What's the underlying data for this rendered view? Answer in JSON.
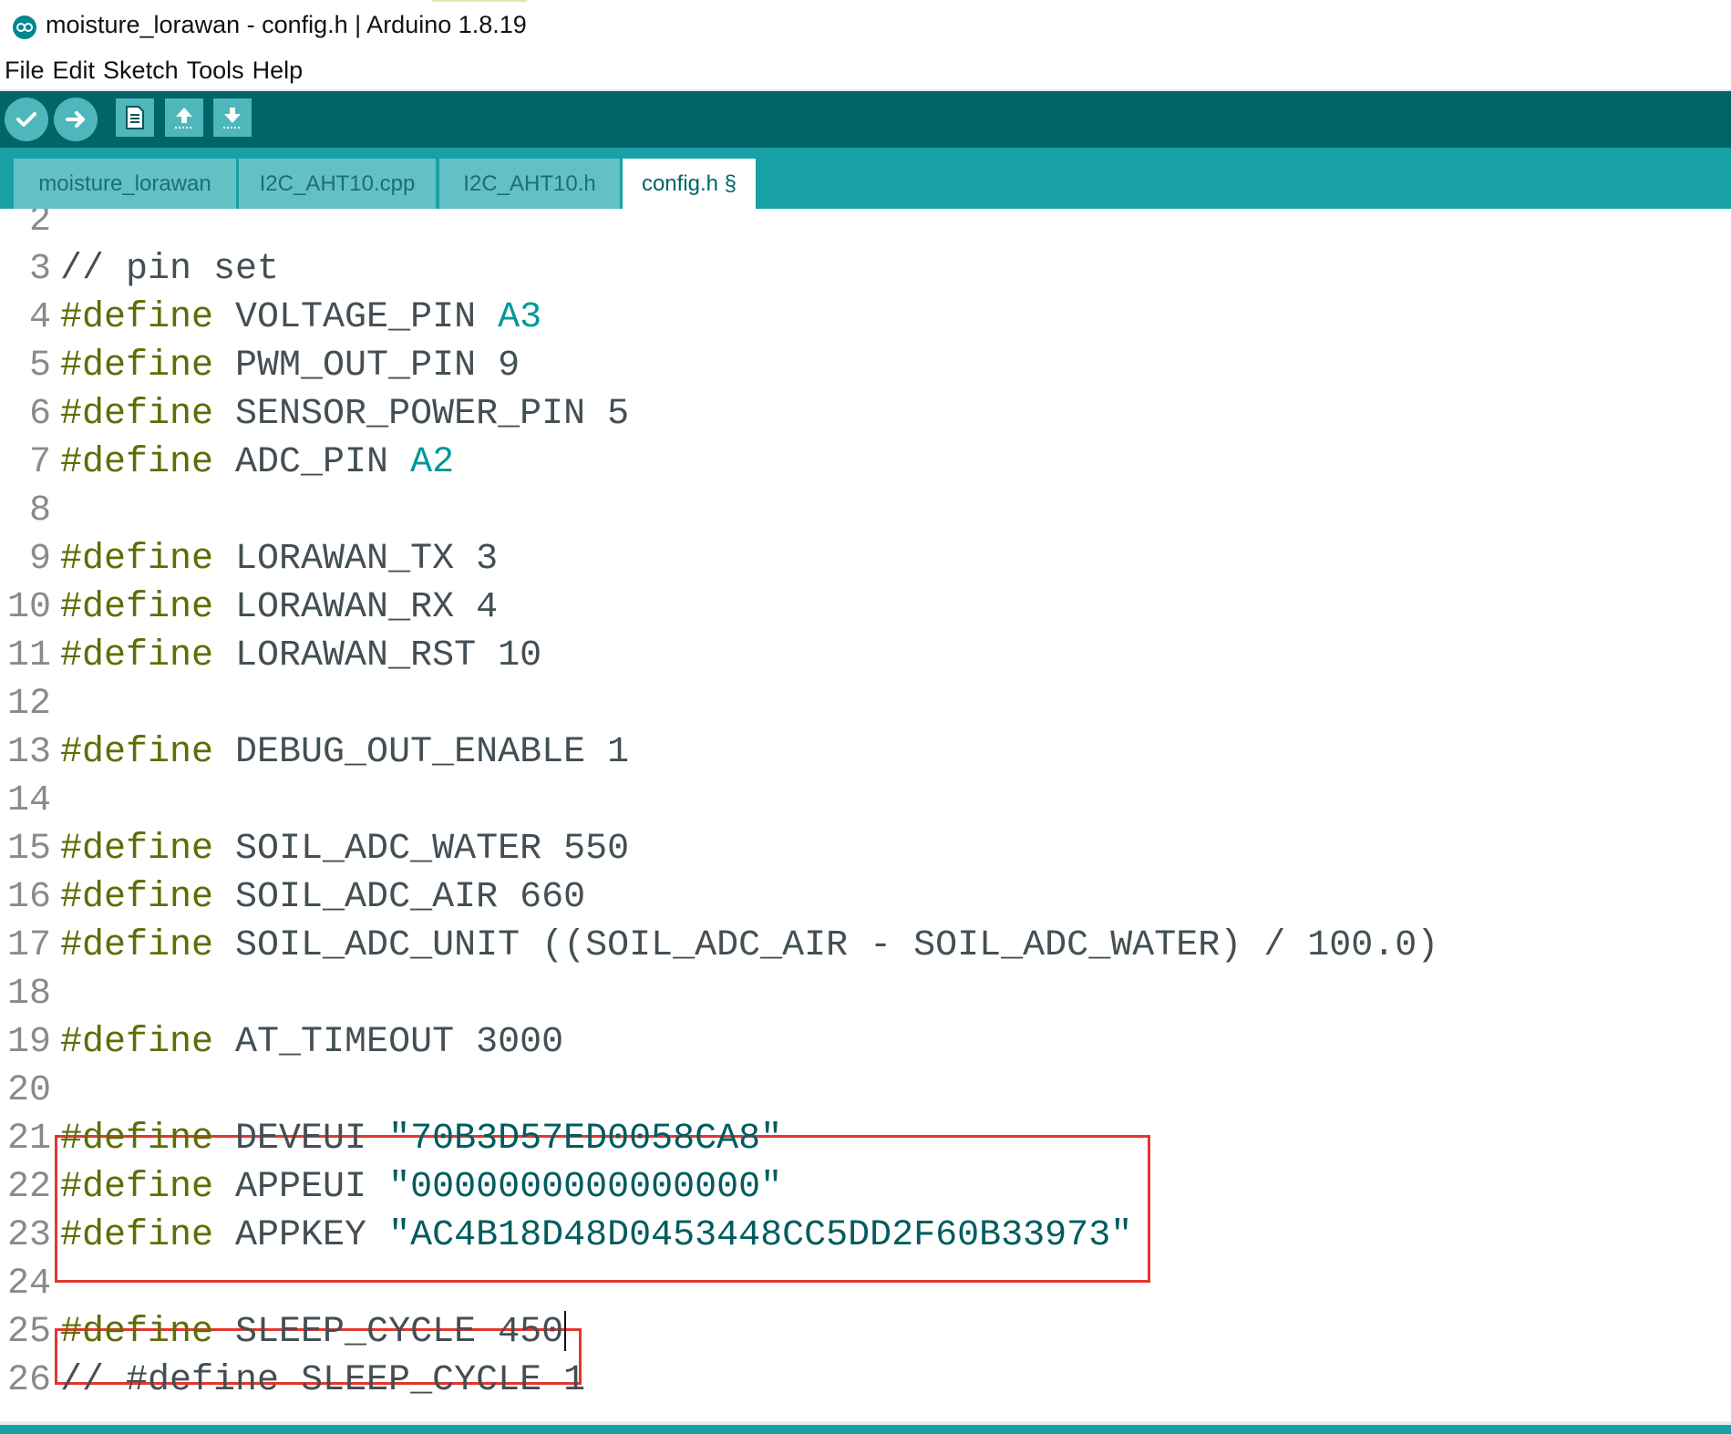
{
  "window": {
    "title": "moisture_lorawan - config.h | Arduino 1.8.19",
    "icon": "arduino-infinity-icon"
  },
  "menu": {
    "items": [
      "File",
      "Edit",
      "Sketch",
      "Tools",
      "Help"
    ]
  },
  "toolbar": {
    "buttons": [
      "verify-icon",
      "upload-icon",
      "new-icon",
      "open-icon",
      "save-icon"
    ]
  },
  "tabs": [
    {
      "label": "moisture_lorawan",
      "active": false
    },
    {
      "label": "I2C_AHT10.cpp",
      "active": false
    },
    {
      "label": "I2C_AHT10.h",
      "active": false
    },
    {
      "label": "config.h §",
      "active": true
    }
  ],
  "editor": {
    "lines": [
      {
        "n": "2",
        "tokens": []
      },
      {
        "n": "3",
        "tokens": [
          {
            "c": "cm",
            "t": "// pin set"
          }
        ]
      },
      {
        "n": "4",
        "tokens": [
          {
            "c": "kw",
            "t": "#define"
          },
          {
            "c": "tx",
            "t": " VOLTAGE_PIN "
          },
          {
            "c": "lit",
            "t": "A3"
          }
        ]
      },
      {
        "n": "5",
        "tokens": [
          {
            "c": "kw",
            "t": "#define"
          },
          {
            "c": "tx",
            "t": " PWM_OUT_PIN 9"
          }
        ]
      },
      {
        "n": "6",
        "tokens": [
          {
            "c": "kw",
            "t": "#define"
          },
          {
            "c": "tx",
            "t": " SENSOR_POWER_PIN 5"
          }
        ]
      },
      {
        "n": "7",
        "tokens": [
          {
            "c": "kw",
            "t": "#define"
          },
          {
            "c": "tx",
            "t": " ADC_PIN "
          },
          {
            "c": "lit",
            "t": "A2"
          }
        ]
      },
      {
        "n": "8",
        "tokens": []
      },
      {
        "n": "9",
        "tokens": [
          {
            "c": "kw",
            "t": "#define"
          },
          {
            "c": "tx",
            "t": " LORAWAN_TX 3"
          }
        ]
      },
      {
        "n": "10",
        "tokens": [
          {
            "c": "kw",
            "t": "#define"
          },
          {
            "c": "tx",
            "t": " LORAWAN_RX 4"
          }
        ]
      },
      {
        "n": "11",
        "tokens": [
          {
            "c": "kw",
            "t": "#define"
          },
          {
            "c": "tx",
            "t": " LORAWAN_RST 10"
          }
        ]
      },
      {
        "n": "12",
        "tokens": []
      },
      {
        "n": "13",
        "tokens": [
          {
            "c": "kw",
            "t": "#define"
          },
          {
            "c": "tx",
            "t": " DEBUG_OUT_ENABLE 1"
          }
        ]
      },
      {
        "n": "14",
        "tokens": []
      },
      {
        "n": "15",
        "tokens": [
          {
            "c": "kw",
            "t": "#define"
          },
          {
            "c": "tx",
            "t": " SOIL_ADC_WATER 550"
          }
        ]
      },
      {
        "n": "16",
        "tokens": [
          {
            "c": "kw",
            "t": "#define"
          },
          {
            "c": "tx",
            "t": " SOIL_ADC_AIR 660"
          }
        ]
      },
      {
        "n": "17",
        "tokens": [
          {
            "c": "kw",
            "t": "#define"
          },
          {
            "c": "tx",
            "t": " SOIL_ADC_UNIT ((SOIL_ADC_AIR - SOIL_ADC_WATER) / 100.0)"
          }
        ]
      },
      {
        "n": "18",
        "tokens": []
      },
      {
        "n": "19",
        "tokens": [
          {
            "c": "kw",
            "t": "#define"
          },
          {
            "c": "tx",
            "t": " AT_TIMEOUT 3000"
          }
        ]
      },
      {
        "n": "20",
        "tokens": []
      },
      {
        "n": "21",
        "tokens": [
          {
            "c": "kw",
            "t": "#define"
          },
          {
            "c": "tx",
            "t": " DEVEUI "
          },
          {
            "c": "str",
            "t": "\"70B3D57ED0058CA8\""
          }
        ]
      },
      {
        "n": "22",
        "tokens": [
          {
            "c": "kw",
            "t": "#define"
          },
          {
            "c": "tx",
            "t": " APPEUI "
          },
          {
            "c": "str",
            "t": "\"0000000000000000\""
          }
        ]
      },
      {
        "n": "23",
        "tokens": [
          {
            "c": "kw",
            "t": "#define"
          },
          {
            "c": "tx",
            "t": " APPKEY "
          },
          {
            "c": "str",
            "t": "\"AC4B18D48D0453448CC5DD2F60B33973\""
          }
        ]
      },
      {
        "n": "24",
        "tokens": []
      },
      {
        "n": "25",
        "tokens": [
          {
            "c": "kw",
            "t": "#define"
          },
          {
            "c": "tx",
            "t": " SLEEP_CYCLE 450"
          }
        ],
        "cursor": true
      },
      {
        "n": "26",
        "tokens": [
          {
            "c": "cm",
            "t": "// #define SLEEP_CYCLE 1"
          }
        ]
      }
    ],
    "highlight_color": "#e0382e"
  },
  "colors": {
    "toolbar": "#006468",
    "tabbar": "#17a1a5",
    "keyword": "#5e6d03",
    "literal": "#00979c",
    "string": "#005c5f"
  }
}
